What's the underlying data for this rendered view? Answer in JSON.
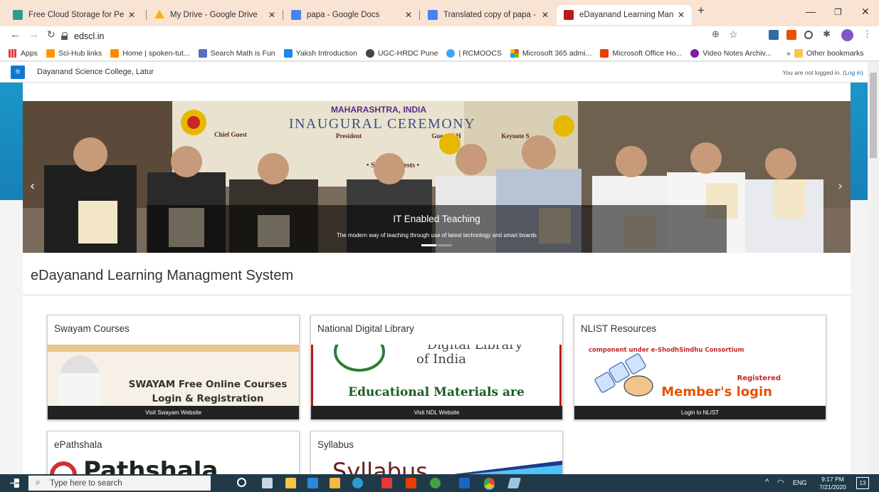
{
  "browser": {
    "tabs": [
      {
        "title": "Free Cloud Storage for Personal U",
        "favicon": "#2a9d8f"
      },
      {
        "title": "My Drive - Google Drive",
        "favicon": "#f4b400"
      },
      {
        "title": "papa - Google Docs",
        "favicon": "#4285f4"
      },
      {
        "title": "Translated copy of papa - Google",
        "favicon": "#4285f4"
      },
      {
        "title": "eDayanand Learning Managment",
        "favicon": "#b71c1c"
      }
    ],
    "url": "edscl.in",
    "bookmarks": [
      {
        "label": "Apps",
        "color": "#e53935"
      },
      {
        "label": "Sci-Hub links",
        "color": "#ff9800"
      },
      {
        "label": "Home | spoken-tut...",
        "color": "#fb8c00"
      },
      {
        "label": "Search Math is Fun",
        "color": "#5c6bc0"
      },
      {
        "label": "Yaksh Introduction",
        "color": "#1e88e5"
      },
      {
        "label": "UGC-HRDC Pune",
        "color": "#444444"
      },
      {
        "label": "| RCMOOCS",
        "color": "#42a5f5"
      },
      {
        "label": "Microsoft 365 admi...",
        "color": "#f25022"
      },
      {
        "label": "Microsoft Office Ho...",
        "color": "#eb3c00"
      },
      {
        "label": "Video Notes Archiv...",
        "color": "#7b1fa2"
      }
    ],
    "other_bookmarks": "Other bookmarks",
    "chevron": "»"
  },
  "site": {
    "name": "Dayanand Science College, Latur",
    "login_prefix": "You are not logged in. (",
    "login_link": "Log in",
    "login_suffix": ")",
    "banner_text": {
      "state": "MAHARASHTRA, INDIA",
      "event": "INAUGURAL CEREMONY",
      "chief": "Chief Guest",
      "president": "President",
      "guest": "Guest of H",
      "keynote": "Keynote S",
      "special": "• Special Guests •"
    },
    "carousel": {
      "title": "IT Enabled Teaching",
      "subtitle": "The modern way of teaching through use of latest technology and smart boards"
    },
    "heading": "eDayanand Learning Managment System",
    "cards": [
      {
        "title": "Swayam Courses",
        "footer": "Visit Swayam Website",
        "img_line1": "SWAYAM Free Online Courses",
        "img_line2": "Login & Registration"
      },
      {
        "title": "National Digital Library",
        "footer": "Visit NDL Website",
        "img_line1": "Digital Library",
        "img_line2": "of India",
        "img_line3": "Educational Materials are"
      },
      {
        "title": "NLIST Resources",
        "footer": "Login to NLIST",
        "img_line1": "component under e-ShodhSindhu Consortium",
        "img_line2": "Registered",
        "img_line3": "Member's login"
      },
      {
        "title": "ePathshala",
        "img_line1": "Pathshala"
      },
      {
        "title": "Syllabus",
        "img_line1": "Syllabus"
      }
    ]
  },
  "taskbar": {
    "search_placeholder": "Type here to search",
    "lang": "ENG",
    "time": "9:17 PM",
    "date": "7/21/2020",
    "notif": "13"
  }
}
